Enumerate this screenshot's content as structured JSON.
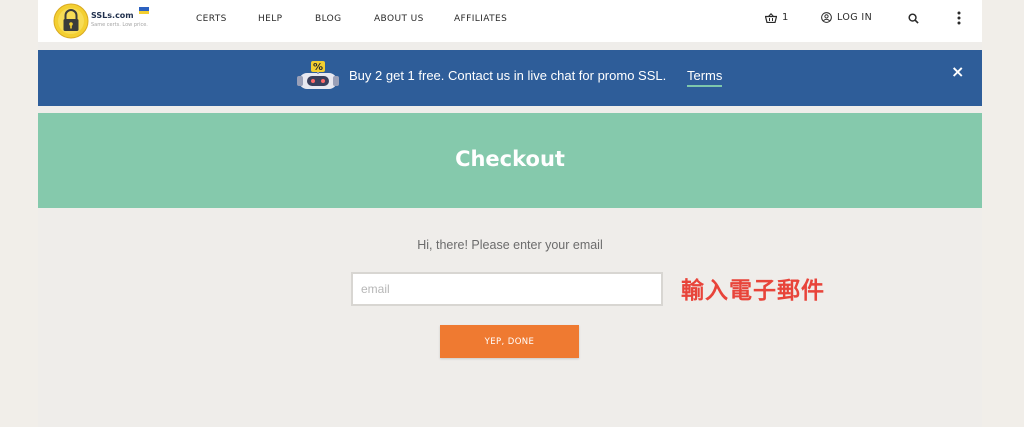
{
  "header": {
    "brand": "SSLs.com",
    "tagline": "Same certs. Low price.",
    "nav": [
      {
        "label": "CERTS"
      },
      {
        "label": "HELP"
      },
      {
        "label": "BLOG"
      },
      {
        "label": "ABOUT US"
      },
      {
        "label": "AFFILIATES"
      }
    ],
    "cart_count": "1",
    "login_label": "LOG IN",
    "icons": {
      "cart": "basket-icon",
      "login": "user-circle-icon",
      "search": "search-icon",
      "more": "vertical-dots-icon"
    }
  },
  "promo": {
    "text": "Buy 2 get 1 free. Contact us in live chat for promo SSL.",
    "terms_label": "Terms",
    "close_glyph": "×",
    "robot_badge": "%"
  },
  "banner": {
    "title": "Checkout"
  },
  "form": {
    "greeting": "Hi, there! Please enter your email",
    "email_placeholder": "email",
    "email_value": "",
    "submit_label": "YEP, DONE",
    "annotation": "輸入電子郵件"
  },
  "colors": {
    "promo_bg": "#2e5d99",
    "banner_bg": "#85c9ac",
    "button_bg": "#ef7a31",
    "annotation": "#e8443a",
    "logo_yellow": "#f3cf31"
  }
}
